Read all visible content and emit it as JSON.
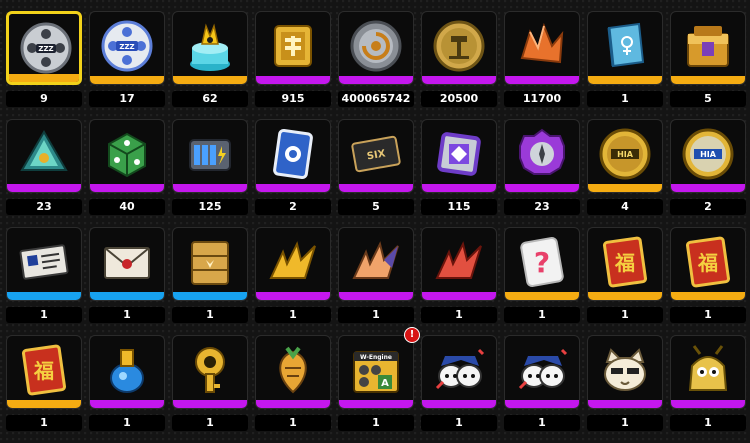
{
  "colors": {
    "gold": "#f5ac12",
    "purple": "#c417ee",
    "blue": "#17a2f0",
    "selected": "#f2d21a"
  },
  "items": [
    {
      "qty": "9",
      "rarity": "gold",
      "icon": "film-reel-icon",
      "selected": true
    },
    {
      "qty": "17",
      "rarity": "gold",
      "icon": "master-tape-reel-icon"
    },
    {
      "qty": "62",
      "rarity": "gold",
      "icon": "bangboo-device-icon"
    },
    {
      "qty": "915",
      "rarity": "purple",
      "icon": "gold-chip-box-icon"
    },
    {
      "qty": "400065742",
      "rarity": "purple",
      "icon": "denny-coin-icon"
    },
    {
      "qty": "20500",
      "rarity": "purple",
      "icon": "polychrome-coin-icon"
    },
    {
      "qty": "11700",
      "rarity": "purple",
      "icon": "orange-crystal-icon"
    },
    {
      "qty": "1",
      "rarity": "gold",
      "icon": "blue-book-icon"
    },
    {
      "qty": "5",
      "rarity": "gold",
      "icon": "treasure-box-icon"
    },
    {
      "qty": "23",
      "rarity": "purple",
      "icon": "teal-ether-crystal-icon"
    },
    {
      "qty": "40",
      "rarity": "purple",
      "icon": "green-dice-icon"
    },
    {
      "qty": "125",
      "rarity": "purple",
      "icon": "battery-pack-icon"
    },
    {
      "qty": "2",
      "rarity": "purple",
      "icon": "blue-card-icon"
    },
    {
      "qty": "5",
      "rarity": "purple",
      "icon": "ticket-plate-icon"
    },
    {
      "qty": "115",
      "rarity": "purple",
      "icon": "purple-chip-icon"
    },
    {
      "qty": "23",
      "rarity": "purple",
      "icon": "purple-gear-icon"
    },
    {
      "qty": "4",
      "rarity": "gold",
      "icon": "gold-hia-coin-icon"
    },
    {
      "qty": "2",
      "rarity": "purple",
      "icon": "blue-hia-coin-icon"
    },
    {
      "qty": "1",
      "rarity": "blue",
      "icon": "ticket-stub-icon"
    },
    {
      "qty": "1",
      "rarity": "blue",
      "icon": "envelope-icon"
    },
    {
      "qty": "1",
      "rarity": "blue",
      "icon": "wooden-crate-icon"
    },
    {
      "qty": "1",
      "rarity": "purple",
      "icon": "gold-feather-icon"
    },
    {
      "qty": "1",
      "rarity": "purple",
      "icon": "peach-feather-icon"
    },
    {
      "qty": "1",
      "rarity": "purple",
      "icon": "red-feather-icon"
    },
    {
      "qty": "1",
      "rarity": "gold",
      "icon": "mystery-card-icon"
    },
    {
      "qty": "1",
      "rarity": "gold",
      "icon": "red-charm-icon"
    },
    {
      "qty": "1",
      "rarity": "gold",
      "icon": "red-charm-icon"
    },
    {
      "qty": "1",
      "rarity": "gold",
      "icon": "red-charm-icon"
    },
    {
      "qty": "1",
      "rarity": "purple",
      "icon": "blue-bottle-icon"
    },
    {
      "qty": "1",
      "rarity": "purple",
      "icon": "gold-key-icon"
    },
    {
      "qty": "1",
      "rarity": "purple",
      "icon": "carrot-badge-icon"
    },
    {
      "qty": "1",
      "rarity": "purple",
      "icon": "w-engine-box-icon",
      "badge": "!",
      "label": "W-Engine"
    },
    {
      "qty": "1",
      "rarity": "purple",
      "icon": "police-cat-icon"
    },
    {
      "qty": "1",
      "rarity": "purple",
      "icon": "police-cat-icon"
    },
    {
      "qty": "1",
      "rarity": "purple",
      "icon": "cream-cat-icon"
    },
    {
      "qty": "1",
      "rarity": "purple",
      "icon": "gold-cat-bag-icon"
    }
  ]
}
